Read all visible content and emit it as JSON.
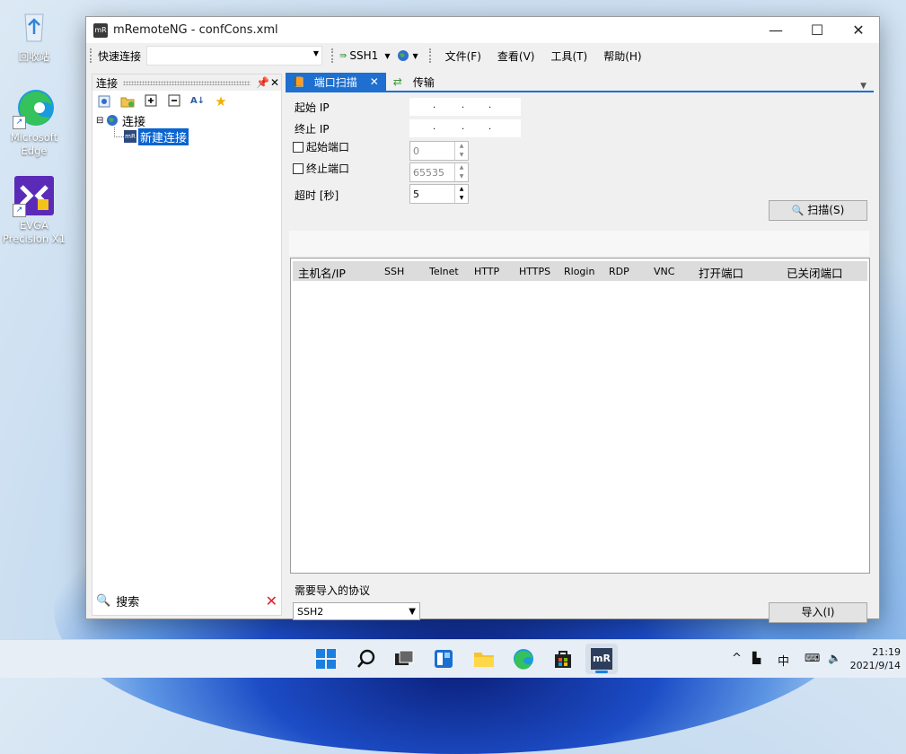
{
  "desktop": {
    "icons": [
      {
        "label": "回收站"
      },
      {
        "label": "Microsoft Edge"
      },
      {
        "label": "EVGA Precision X1"
      }
    ]
  },
  "window": {
    "title": "mRemoteNG - confCons.xml",
    "logo_text": "mR",
    "controls": {
      "minimize": "—",
      "maximize": "☐",
      "close": "✕"
    }
  },
  "toolbar": {
    "quick_connect_label": "快速连接",
    "quick_connect_value": "",
    "protocol_button": "SSH1",
    "menus": [
      "文件(F)",
      "查看(V)",
      "工具(T)",
      "帮助(H)"
    ]
  },
  "connections_panel": {
    "title": "连接",
    "tree": {
      "root": "连接",
      "child": "新建连接"
    },
    "search_label": "搜索"
  },
  "tabs": [
    {
      "label": "端口扫描",
      "active": true,
      "close": "✕"
    },
    {
      "label": "传输",
      "active": false
    }
  ],
  "port_scan": {
    "start_ip_label": "起始 IP",
    "end_ip_label": "终止 IP",
    "start_port_label": "起始端口",
    "end_port_label": "终止端口",
    "timeout_label": "超时 [秒]",
    "start_port_value": "0",
    "end_port_value": "65535",
    "timeout_value": "5",
    "scan_button": "扫描(S)",
    "columns": [
      "主机名/IP",
      "SSH",
      "Telnet",
      "HTTP",
      "HTTPS",
      "Rlogin",
      "RDP",
      "VNC",
      "打开端口",
      "已关闭端口"
    ],
    "import_protocol_label": "需要导入的协议",
    "import_protocol_value": "SSH2",
    "import_button": "导入(I)"
  },
  "taskbar": {
    "tray": {
      "ime": "中"
    },
    "clock": {
      "time": "21:19",
      "date": "2021/9/14"
    }
  },
  "colors": {
    "accent": "#1e6fd0",
    "selection": "#0a64d0",
    "window_bg": "#f0f0f0"
  }
}
